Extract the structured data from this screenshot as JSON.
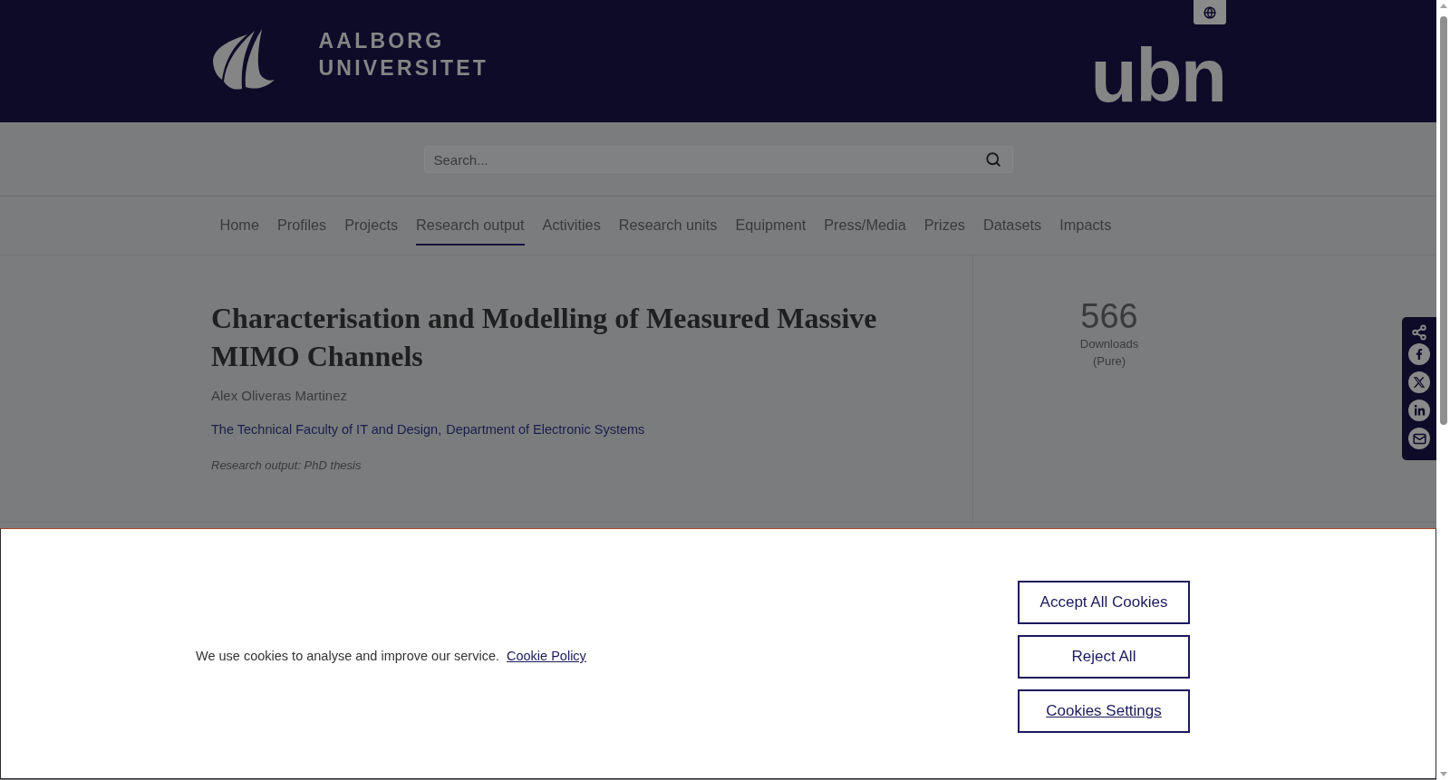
{
  "header": {
    "wordmark": [
      "AALBORG",
      "UNIVERSITET"
    ],
    "partner_logo": "ubn"
  },
  "search": {
    "placeholder": "Search..."
  },
  "nav": [
    {
      "label": "Home",
      "selected": false
    },
    {
      "label": "Profiles",
      "selected": false
    },
    {
      "label": "Projects",
      "selected": false
    },
    {
      "label": "Research output",
      "selected": true
    },
    {
      "label": "Activities",
      "selected": false
    },
    {
      "label": "Research units",
      "selected": false
    },
    {
      "label": "Equipment",
      "selected": false
    },
    {
      "label": "Press/Media",
      "selected": false
    },
    {
      "label": "Prizes",
      "selected": false
    },
    {
      "label": "Datasets",
      "selected": false
    },
    {
      "label": "Impacts",
      "selected": false
    }
  ],
  "publication": {
    "title": "Characterisation and Modelling of Measured Massive MIMO Channels",
    "author": "Alex Oliveras Martinez",
    "organisations": [
      {
        "name": "The Technical Faculty of IT and Design",
        "separator": ","
      },
      {
        "name": "Department of Electronic Systems"
      }
    ],
    "type": "Research output: PhD thesis"
  },
  "metrics": {
    "value": "566",
    "label": "Downloads (Pure)"
  },
  "cookie_banner": {
    "message": "We use cookies to analyse and improve our service.",
    "policy_link": "Cookie Policy",
    "buttons": [
      {
        "label": "Accept All Cookies",
        "kind": "outlined"
      },
      {
        "label": "Reject All",
        "kind": "outlined"
      },
      {
        "label": "Cookies Settings",
        "kind": "link"
      }
    ]
  }
}
